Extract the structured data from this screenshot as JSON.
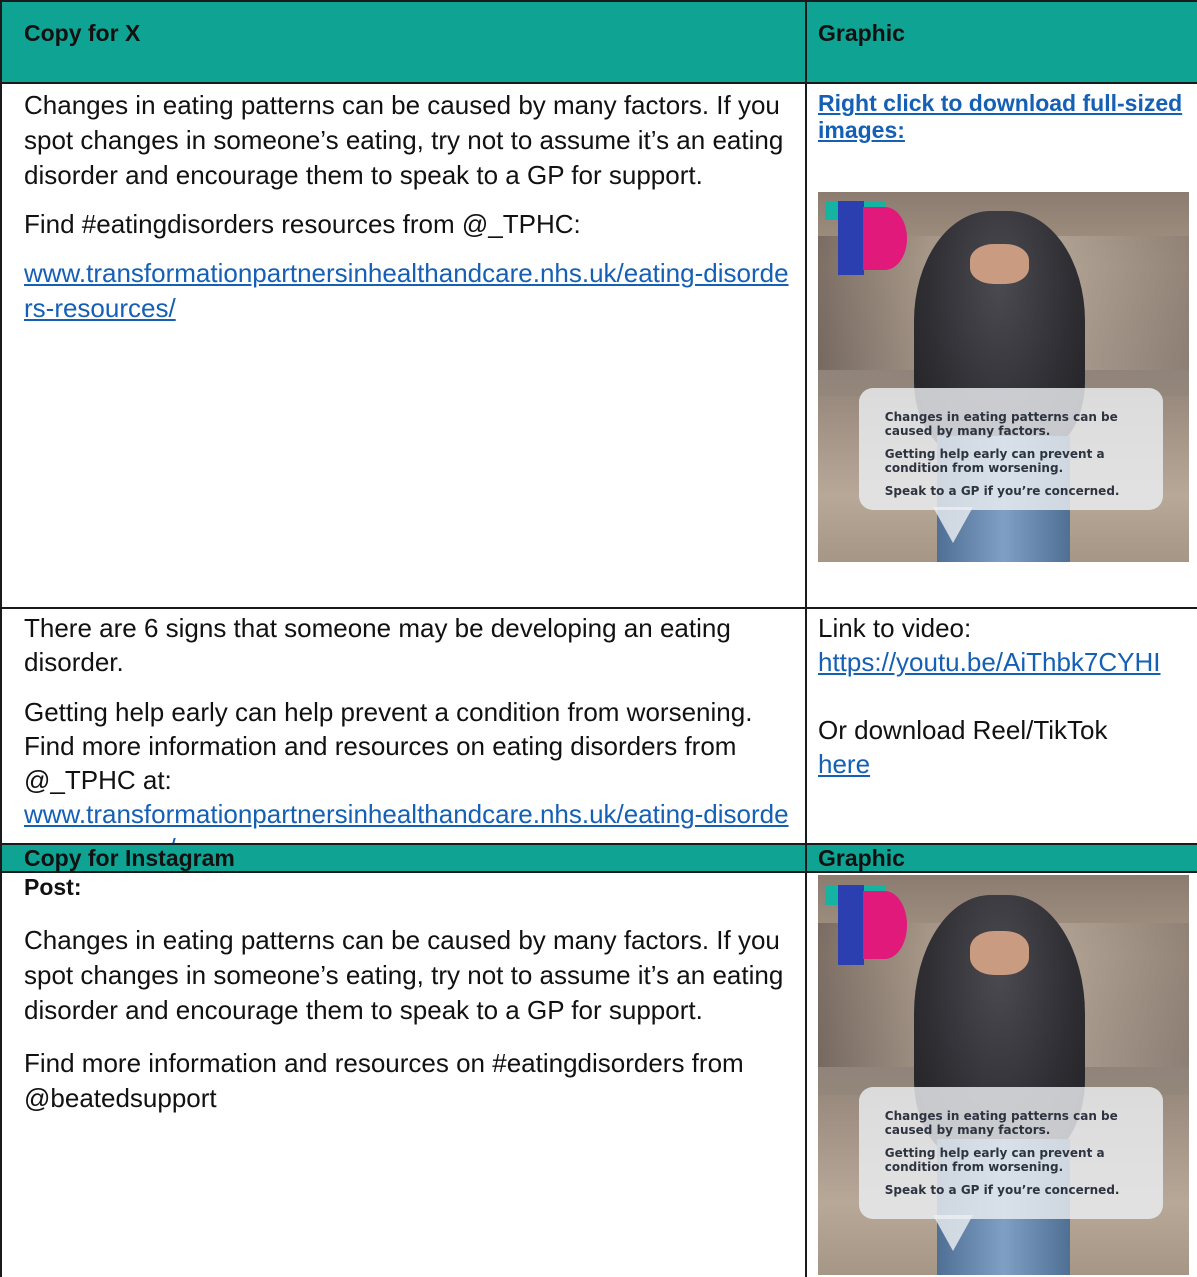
{
  "sections": {
    "x": {
      "header": {
        "copy": "Copy for X",
        "graphic": "Graphic"
      },
      "row1": {
        "para1": "Changes in eating patterns can be caused by many factors. If you spot changes in someone’s eating, try not to assume it’s an eating disorder and encourage them to speak to a GP for support.",
        "para2": "Find #eatingdisorders resources from @_TPHC:",
        "link": "www.transformationpartnersinhealthandcare.nhs.uk/eating-disorders-resources/",
        "download_link": "Right click to download full-sized images:"
      },
      "row2": {
        "para1": "There are 6 signs that someone may be developing an eating disorder.",
        "para2": "Getting help early can help prevent a condition from worsening. Find more information and resources on eating disorders from @_TPHC at:",
        "link": "www.transformationpartnersinhealthandcare.nhs.uk/eating-disorders-resources/",
        "video_label": "Link to video:",
        "video_link": "https://youtu.be/AiThbk7CYHI",
        "reel_label": "Or download Reel/TikTok",
        "reel_link": "here"
      }
    },
    "instagram": {
      "header": {
        "copy": "Copy for Instagram",
        "graphic": "Graphic"
      },
      "post_label": "Post:",
      "para1": "Changes in eating patterns can be caused by many factors. If you spot changes in someone’s eating, try not to assume it’s an eating disorder and encourage them to speak to a GP for support.",
      "para2": "Find more information and resources on #eatingdisorders from @beatedsupport"
    }
  },
  "graphic": {
    "line1": "Changes in eating patterns can be caused by many factors.",
    "line2": "Getting help early can prevent a condition from worsening.",
    "line3": "Speak to a GP if you’re concerned."
  },
  "colors": {
    "header_bg": "#0fa394",
    "link": "#1560b5",
    "logo_teal": "#14b3a2",
    "logo_blue": "#2b3fb0",
    "logo_pink": "#e0197a"
  }
}
